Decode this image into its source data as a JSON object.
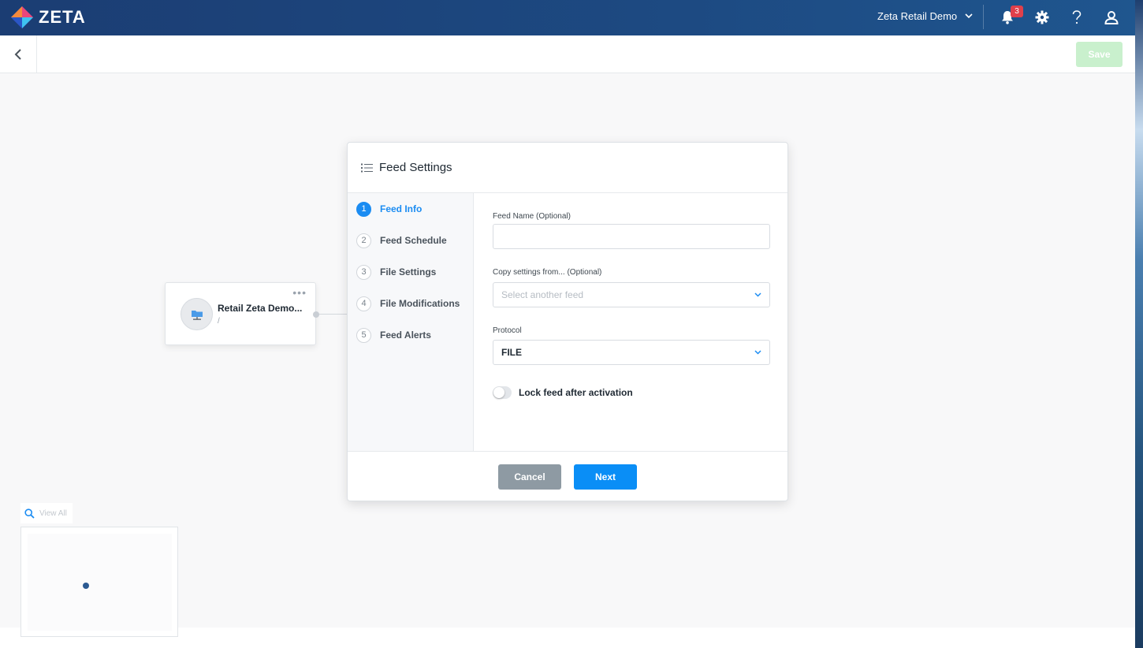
{
  "app": {
    "brand": "ZETA",
    "account_name": "Zeta Retail Demo",
    "notifications_count": "3",
    "icons": [
      "notification-bell-icon",
      "settings-gear-icon",
      "help-question-icon",
      "user-profile-icon"
    ]
  },
  "toolbar": {
    "save_label": "Save"
  },
  "node": {
    "title": "Retail Zeta Demo...",
    "subtitle": "/",
    "icon": "folder-network-icon"
  },
  "minimap": {
    "view_all_label": "View All"
  },
  "modal": {
    "title": "Feed Settings",
    "steps": [
      {
        "num": "1",
        "label": "Feed Info",
        "active": true
      },
      {
        "num": "2",
        "label": "Feed Schedule",
        "active": false
      },
      {
        "num": "3",
        "label": "File Settings",
        "active": false
      },
      {
        "num": "4",
        "label": "File Modifications",
        "active": false
      },
      {
        "num": "5",
        "label": "Feed Alerts",
        "active": false
      }
    ],
    "form": {
      "feed_name_label": "Feed Name (Optional)",
      "feed_name_value": "",
      "copy_settings_label": "Copy settings from... (Optional)",
      "copy_settings_placeholder": "Select another feed",
      "protocol_label": "Protocol",
      "protocol_value": "FILE",
      "lock_label": "Lock feed after activation",
      "lock_enabled": false
    },
    "cancel_label": "Cancel",
    "next_label": "Next"
  },
  "colors": {
    "primary": "#0a8ef6",
    "nav": "#1b3d73",
    "badge": "#e0404b",
    "save_disabled": "#c9f0cd",
    "cancel": "#8e9aa3"
  }
}
